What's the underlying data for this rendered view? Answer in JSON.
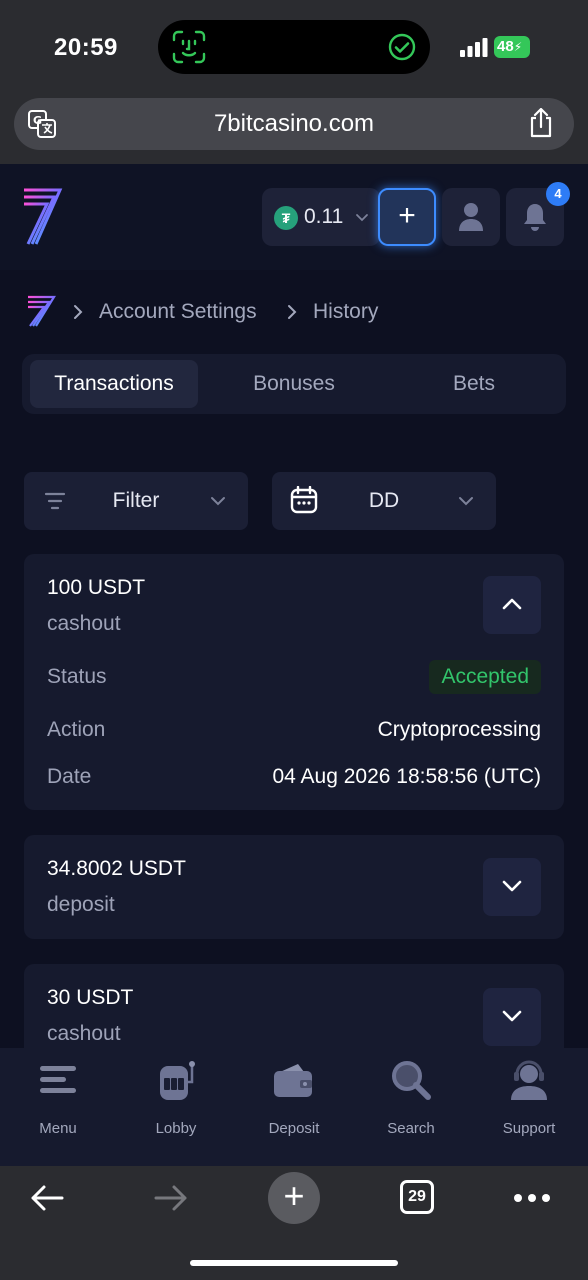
{
  "status_bar": {
    "time": "20:59",
    "battery": "48"
  },
  "browser": {
    "url": "7bitcasino.com",
    "open_tabs": "29"
  },
  "header": {
    "balance": "0.11",
    "currency_symbol": "₮",
    "add_funds_label": "+",
    "notifications_count": "4"
  },
  "breadcrumb": {
    "items": [
      "Account Settings",
      "History"
    ]
  },
  "tabs": [
    {
      "label": "Transactions",
      "active": true
    },
    {
      "label": "Bonuses",
      "active": false
    },
    {
      "label": "Bets",
      "active": false
    }
  ],
  "filters": {
    "filter_label": "Filter",
    "date_label": "DD"
  },
  "transactions": [
    {
      "amount": "100 USDT",
      "type": "cashout",
      "expanded": true,
      "details": {
        "status_label": "Status",
        "status_value": "Accepted",
        "action_label": "Action",
        "action_value": "Cryptoprocessing",
        "date_label": "Date",
        "date_value": "04 Aug 2026 18:58:56 (UTC)"
      }
    },
    {
      "amount": "34.8002 USDT",
      "type": "deposit",
      "expanded": false
    },
    {
      "amount": "30 USDT",
      "type": "cashout",
      "expanded": false
    }
  ],
  "bottom_nav": [
    {
      "label": "Menu",
      "icon": "menu-icon"
    },
    {
      "label": "Lobby",
      "icon": "slot-machine-icon"
    },
    {
      "label": "Deposit",
      "icon": "wallet-icon"
    },
    {
      "label": "Search",
      "icon": "search-icon"
    },
    {
      "label": "Support",
      "icon": "support-agent-icon"
    }
  ],
  "colors": {
    "background": "#0d1021",
    "card": "#161a2e",
    "accent_blue": "#3d8cff",
    "status_accepted": "#32c46b"
  }
}
